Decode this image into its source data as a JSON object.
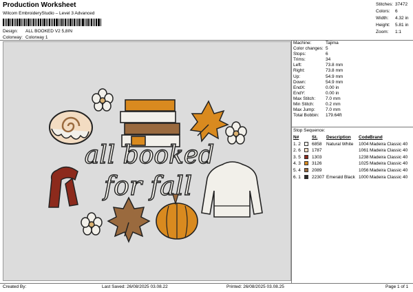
{
  "header": {
    "title": "Production Worksheet",
    "subtitle": "Wilcom EmbroideryStudio – Level 3 Advanced",
    "design_label": "Design:",
    "design_value": "ALL BOOKED V2  5,8IN",
    "colorway_label": "Colorway:",
    "colorway_value": "Colorway 1"
  },
  "stats": [
    {
      "label": "Stitches:",
      "value": "37472"
    },
    {
      "label": "Colors:",
      "value": "6"
    },
    {
      "label": "Width:",
      "value": "4.32 in"
    },
    {
      "label": "Height:",
      "value": "5.81 in"
    },
    {
      "label": "Zoom:",
      "value": "1:1"
    }
  ],
  "design": {
    "text_line1": "all booked",
    "text_line2": "for fall"
  },
  "machine_info": [
    {
      "label": "Machine:",
      "value": "Tajima"
    },
    {
      "label": "Color changes:",
      "value": "5"
    },
    {
      "label": "Stops:",
      "value": "6"
    },
    {
      "label": "Trims:",
      "value": "34"
    },
    {
      "label": "Left:",
      "value": "73.8 mm"
    },
    {
      "label": "Right:",
      "value": "73.8 mm"
    },
    {
      "label": "Up:",
      "value": "54.9 mm"
    },
    {
      "label": "Down:",
      "value": "54.9 mm"
    },
    {
      "label": "EndX:",
      "value": "0.00 in"
    },
    {
      "label": "EndY:",
      "value": "0.00 in"
    },
    {
      "label": "Max Stitch:",
      "value": "7.0 mm"
    },
    {
      "label": "Min Stitch:",
      "value": "0.2 mm"
    },
    {
      "label": "Max Jump:",
      "value": "7.0 mm"
    },
    {
      "label": "Total Bobbin:",
      "value": "179.64ft"
    }
  ],
  "stop_sequence": {
    "title": "Stop Sequence:",
    "headers": {
      "n": "N#",
      "st": "St.",
      "desc": "Description",
      "code": "Code",
      "brand": "Brand"
    },
    "rows": [
      {
        "n": "1. 2",
        "color": "#f2f0ea",
        "st": "6858",
        "desc": "Natural White",
        "code": "1004",
        "brand": "Madeira Classic 40"
      },
      {
        "n": "2. 6",
        "color": "#f3dcc2",
        "st": "1787",
        "desc": "",
        "code": "1061",
        "brand": "Madeira Classic 40"
      },
      {
        "n": "3. 5",
        "color": "#8c2a1c",
        "st": "1303",
        "desc": "",
        "code": "1238",
        "brand": "Madeira Classic 40"
      },
      {
        "n": "4. 3",
        "color": "#d98a1f",
        "st": "3126",
        "desc": "",
        "code": "1025",
        "brand": "Madeira Classic 40"
      },
      {
        "n": "5. 4",
        "color": "#9a6a3e",
        "st": "2089",
        "desc": "",
        "code": "1056",
        "brand": "Madeira Classic 40"
      },
      {
        "n": "6. 1",
        "color": "#2a2a2a",
        "st": "22307",
        "desc": "Emerald Black",
        "code": "1000",
        "brand": "Madeira Classic 40"
      }
    ]
  },
  "footer": {
    "created_by": "Created By:",
    "last_saved": "Last Saved: 26/08/2025 03.08.22",
    "printed": "Printed: 26/08/2025 03.08.25",
    "page": "Page 1 of 1"
  }
}
